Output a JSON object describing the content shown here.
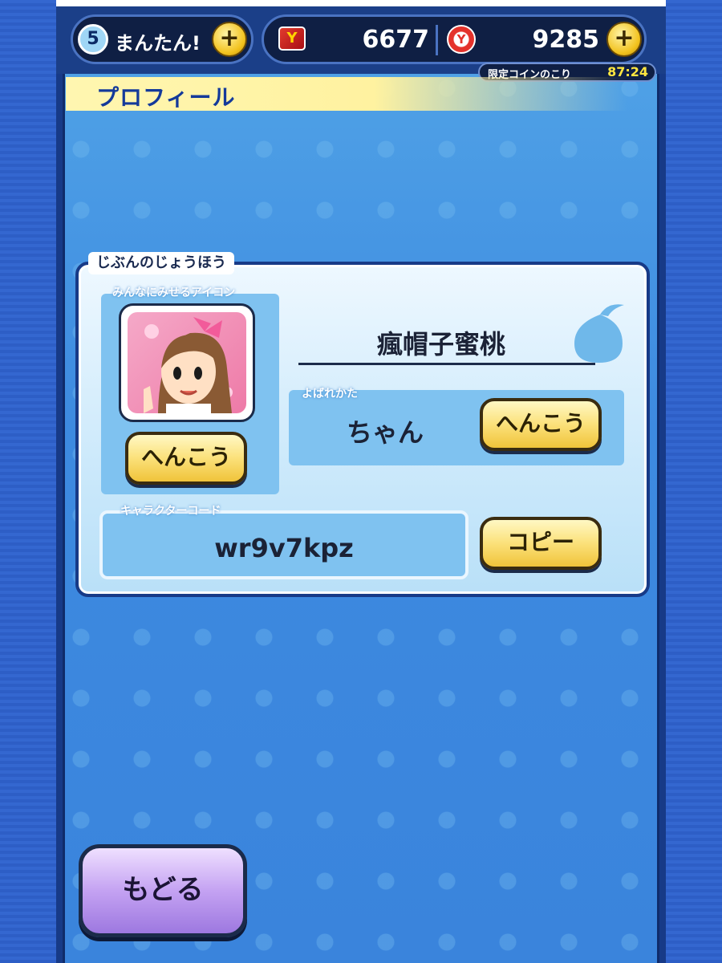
{
  "header": {
    "level_number": "5",
    "difficulty_label": "まんたん!",
    "coin1_value": "6677",
    "coin1_icon": "y-ticket-icon",
    "coin2_value": "9285",
    "coin2_icon": "y-coin-icon",
    "limited_coin_label": "限定コインのこり",
    "limited_coin_time": "87:24",
    "plus_label": "+"
  },
  "page": {
    "title": "プロフィール"
  },
  "panel": {
    "label": "じぶんのじょうほう",
    "icon_section_label": "みんなにみせるアイコン",
    "icon_change_button": "へんこう",
    "player_name": "瘋帽子蜜桃",
    "call_section_label": "よばれかた",
    "call_value": "ちゃん",
    "call_change_button": "へんこう",
    "code_section_label": "キャラクターコード",
    "code_value": "wr9v7kpz",
    "copy_button": "コピー"
  },
  "footer": {
    "back_button": "もどる"
  },
  "colors": {
    "accent_blue": "#3d8ae0",
    "title_blue": "#143a9a",
    "button_yellow": "#fbe17a",
    "button_purple": "#c4a2f2",
    "dark_navy": "#173a87"
  }
}
